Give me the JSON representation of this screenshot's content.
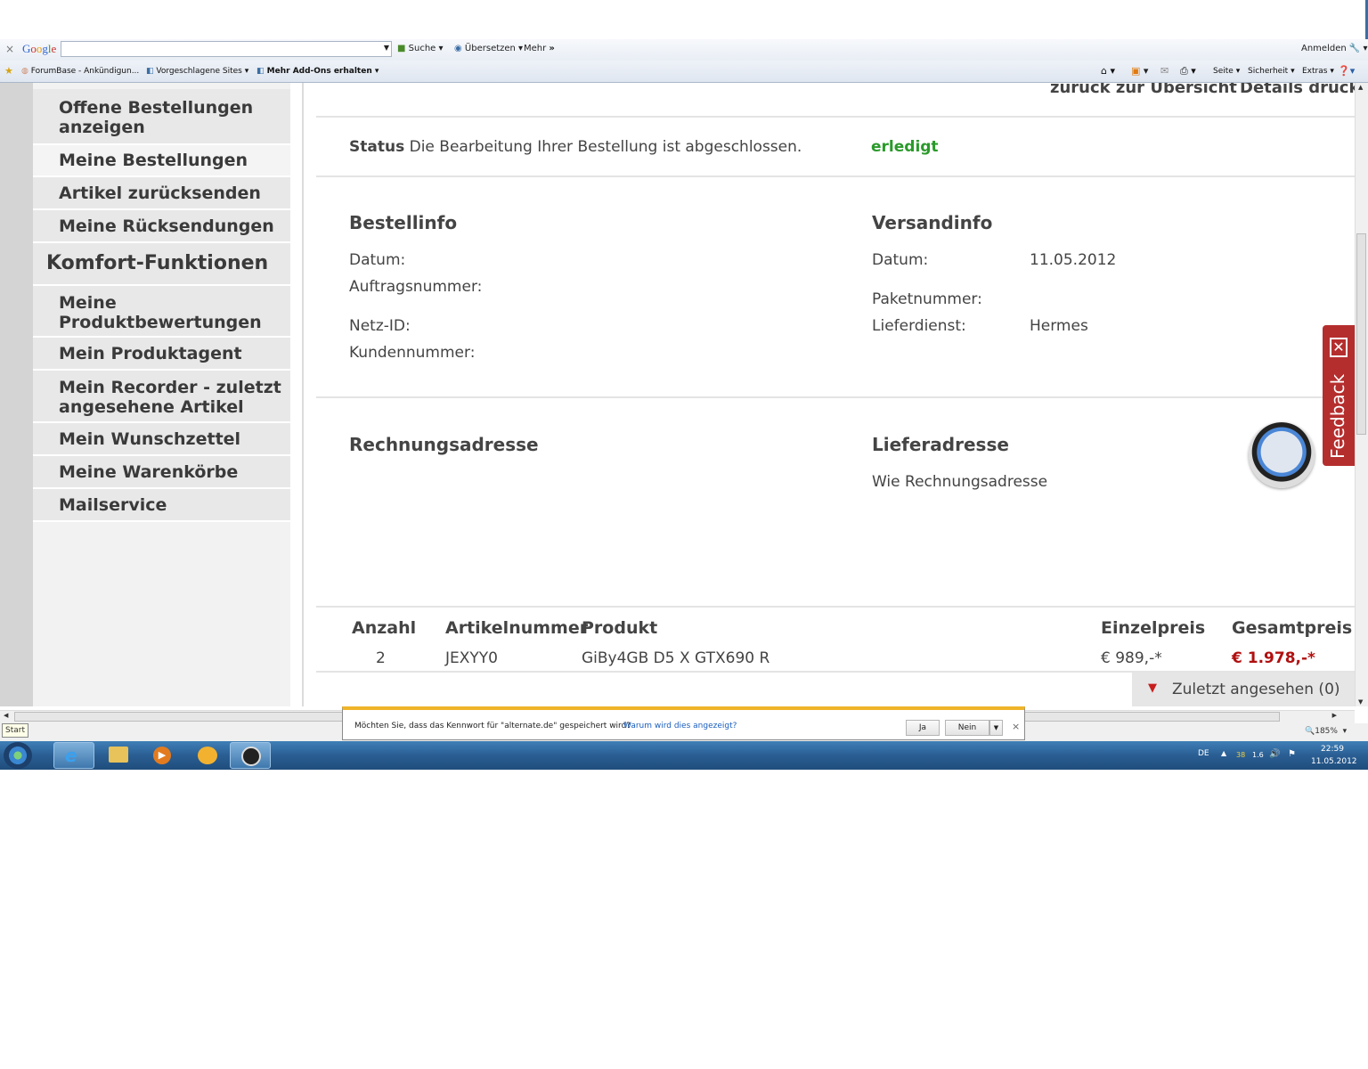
{
  "google_toolbar": {
    "close": "×",
    "logo": [
      "G",
      "o",
      "o",
      "g",
      "l",
      "e"
    ],
    "search_value": "",
    "search_label": "Suche",
    "translate_label": "Übersetzen",
    "more_label": "Mehr",
    "more_arrows": "»",
    "signin_label": "Anmelden"
  },
  "favorites": {
    "item1": "ForumBase - Ankündigun...",
    "item2": "Vorgeschlagene Sites",
    "item3": "Mehr Add-Ons erhalten",
    "page_label": "Seite",
    "safety_label": "Sicherheit",
    "tools_label": "Extras"
  },
  "sidebar": {
    "items": [
      "Offene Bestellungen anzeigen",
      "Meine Bestellungen",
      "Artikel zurücksenden",
      "Meine Rücksendungen"
    ],
    "section_heading": "Komfort-Funktionen",
    "items2": [
      "Meine Produktbewertungen",
      "Mein Produktagent",
      "Mein Recorder - zuletzt angesehene Artikel",
      "Mein Wunschzettel",
      "Meine Warenkörbe",
      "Mailservice"
    ]
  },
  "header_links": {
    "back": "zurück zur Übersicht",
    "print": "Details drucke"
  },
  "status": {
    "label": "Status",
    "text": "Die Bearbeitung Ihrer Bestellung ist abgeschlossen.",
    "value": "erledigt",
    "value_color": "#2a9a2a"
  },
  "order_info": {
    "heading": "Bestellinfo",
    "date_label": "Datum:",
    "order_number_label": "Auftragsnummer:",
    "net_id_label": "Netz-ID:",
    "customer_number_label": "Kundennummer:"
  },
  "shipping_info": {
    "heading": "Versandinfo",
    "date_label": "Datum:",
    "date_value": "11.05.2012",
    "package_label": "Paketnummer:",
    "carrier_label": "Lieferdienst:",
    "carrier_value": "Hermes"
  },
  "addresses": {
    "billing_heading": "Rechnungsadresse",
    "delivery_heading": "Lieferadresse",
    "delivery_text": "Wie Rechnungsadresse"
  },
  "feedback": {
    "label": "Feedback"
  },
  "items_table": {
    "headers": [
      "Anzahl",
      "Artikelnummer",
      "Produkt",
      "Einzelpreis",
      "Gesamtpreis"
    ],
    "rows": [
      {
        "qty": "2",
        "sku": "JEXYY0",
        "product": "GiBy4GB D5 X GTX690 R",
        "unit_price": "€ 989,-*",
        "total_price": "€ 1.978,-*"
      }
    ],
    "total_color": "#b01010"
  },
  "recently_viewed": {
    "label": "Zuletzt angesehen (0)"
  },
  "statusbar": {
    "start_tooltip": "Start",
    "zoom": "185%"
  },
  "password_prompt": {
    "question": "Möchten Sie, dass das Kennwort für \"alternate.de\" gespeichert wird?",
    "why_link": "Warum wird dies angezeigt?",
    "yes": "Ja",
    "no": "Nein",
    "close": "×"
  },
  "tray": {
    "lang": "DE",
    "temp": "38",
    "cpu": "1.6",
    "time": "22:59",
    "date": "11.05.2012"
  }
}
